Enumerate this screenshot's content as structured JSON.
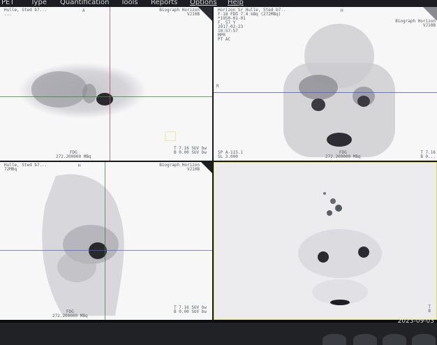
{
  "menu": {
    "items": [
      "PET",
      "Type",
      "Quantification",
      "Tools",
      "Reports",
      "Options",
      "Help"
    ]
  },
  "viewports": {
    "transaxial": {
      "nw": [
        "Hulle, Sted b7...",
        "..."
      ],
      "ne": [
        "Biograph Horizon",
        "VJ10B"
      ],
      "orient_top": "A",
      "sw": [
        "FDG",
        "272.200000 MBq"
      ],
      "se": [
        "T 7.16 SUV bw",
        "B 0.00 SUV bw"
      ]
    },
    "coronal": {
      "nw": [
        "Horizon_Sr_Hulle, Sted b7..",
        "F-18 FDG 7.4 kBq (272MBq)",
        "*1950-01-01",
        "F, 57 Y",
        "2017-02-23",
        "10:57:57",
        "",
        "MPR",
        "PT AC"
      ],
      "ne": [
        "Biograph Horizon",
        "VJ10B"
      ],
      "orient_top": "H",
      "orient_left": "R",
      "sw": [
        "SP A-115.1",
        "SL 3.000"
      ],
      "bottom_center": [
        "FDG",
        "272.200000 MBq"
      ],
      "se": [
        "T 7.16",
        "B 0..."
      ]
    },
    "sagittal": {
      "nw": [
        "Hulle, Sted b7...",
        "72MBq"
      ],
      "ne": [
        "Biograph Horizon",
        "VJ10B"
      ],
      "orient_top": "H",
      "sw": [
        "FDG",
        "272.200000 MBq"
      ],
      "se": [
        "T 7.16 SUV bw",
        "B 0.00 SUV bw"
      ]
    },
    "mip": {
      "se": [
        "T",
        "B"
      ]
    }
  },
  "status": {
    "date": "2023-09-03"
  },
  "colors": {
    "crosshair_h": "#3a8a3a",
    "crosshair_v": "#b54a6a",
    "crosshair_blue": "#4a5bd0",
    "active_border": "#e0dc5a"
  }
}
